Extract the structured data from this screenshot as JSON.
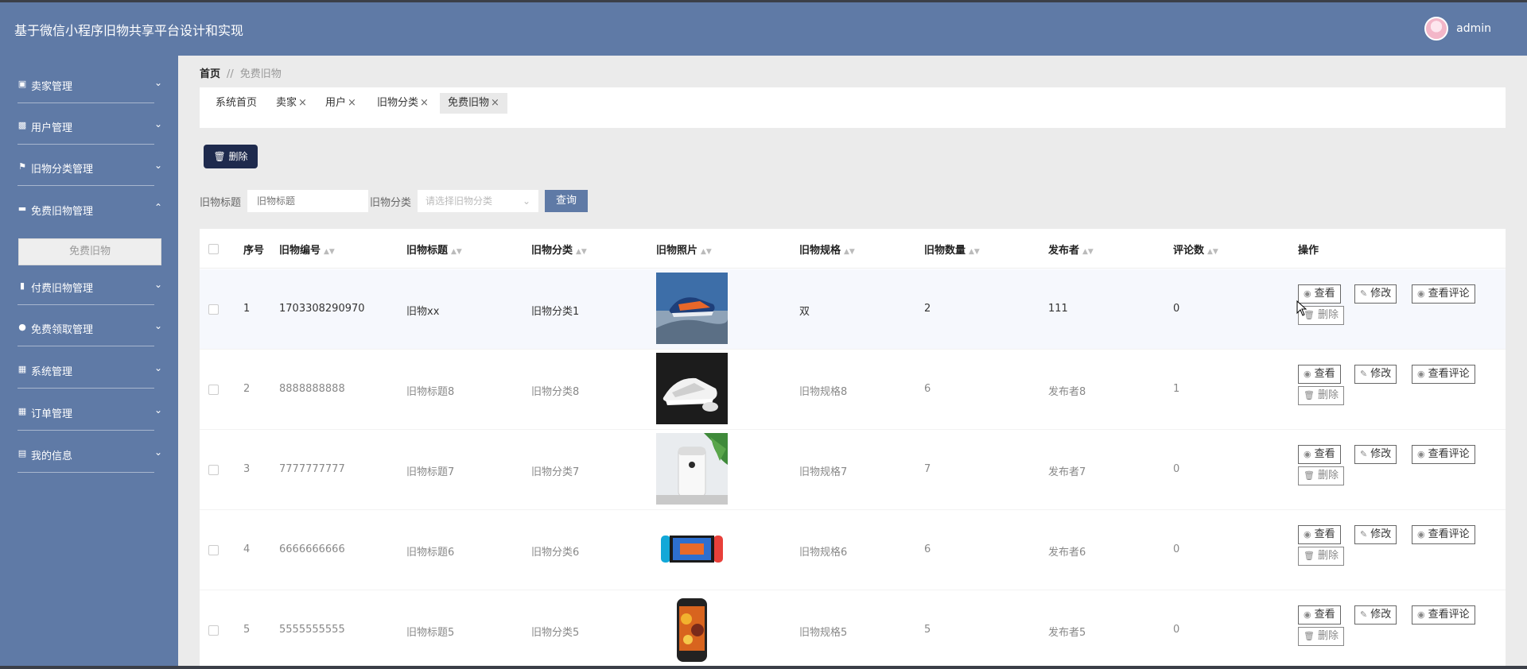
{
  "app": {
    "title": "基于微信小程序旧物共享平台设计和实现",
    "user": "admin"
  },
  "sidebar": {
    "items": [
      {
        "label": "卖家管理",
        "icon": "seller-icon"
      },
      {
        "label": "用户管理",
        "icon": "user-group-icon"
      },
      {
        "label": "旧物分类管理",
        "icon": "flag-icon"
      },
      {
        "label": "免费旧物管理",
        "icon": "ticket-icon",
        "expanded": true
      },
      {
        "label": "付费旧物管理",
        "icon": "bar-chart-icon"
      },
      {
        "label": "免费领取管理",
        "icon": "pin-icon"
      },
      {
        "label": "系统管理",
        "icon": "grid-icon"
      },
      {
        "label": "订单管理",
        "icon": "grid-icon"
      },
      {
        "label": "我的信息",
        "icon": "id-card-icon"
      }
    ],
    "submenu": "免费旧物"
  },
  "breadcrumb": {
    "home": "首页",
    "sep": "//",
    "current": "免费旧物"
  },
  "tabs": [
    {
      "label": "系统首页",
      "closable": false
    },
    {
      "label": "卖家",
      "closable": true
    },
    {
      "label": "用户",
      "closable": true
    },
    {
      "label": "旧物分类",
      "closable": true
    },
    {
      "label": "免费旧物",
      "closable": true,
      "active": true
    }
  ],
  "toolbar": {
    "delete_label": "删除"
  },
  "search": {
    "title_label": "旧物标题",
    "title_placeholder": "旧物标题",
    "category_label": "旧物分类",
    "category_placeholder": "请选择旧物分类",
    "query_label": "查询"
  },
  "table": {
    "headers": [
      "序号",
      "旧物编号",
      "旧物标题",
      "旧物分类",
      "旧物照片",
      "旧物规格",
      "旧物数量",
      "发布者",
      "评论数",
      "操作"
    ],
    "rows": [
      {
        "index": "1",
        "code": "1703308290970",
        "title": "旧物xx",
        "category": "旧物分类1",
        "photo": "shoe-blue-photo",
        "spec": "双",
        "qty": "2",
        "publisher": "111",
        "comments": "0"
      },
      {
        "index": "2",
        "code": "8888888888",
        "title": "旧物标题8",
        "category": "旧物分类8",
        "photo": "shoe-white-photo",
        "spec": "旧物规格8",
        "qty": "6",
        "publisher": "发布者8",
        "comments": "1"
      },
      {
        "index": "3",
        "code": "7777777777",
        "title": "旧物标题7",
        "category": "旧物分类7",
        "photo": "purifier-photo",
        "spec": "旧物规格7",
        "qty": "7",
        "publisher": "发布者7",
        "comments": "0"
      },
      {
        "index": "4",
        "code": "6666666666",
        "title": "旧物标题6",
        "category": "旧物分类6",
        "photo": "game-console-photo",
        "spec": "旧物规格6",
        "qty": "6",
        "publisher": "发布者6",
        "comments": "0"
      },
      {
        "index": "5",
        "code": "5555555555",
        "title": "旧物标题5",
        "category": "旧物分类5",
        "photo": "phone-photo",
        "spec": "旧物规格5",
        "qty": "5",
        "publisher": "发布者5",
        "comments": "0"
      }
    ],
    "actions": {
      "view": "查看",
      "edit": "修改",
      "view_comments": "查看评论",
      "delete": "删除"
    }
  },
  "colors": {
    "header": "#5f7aa6",
    "sidebar": "#5f7aa6",
    "primary_dark": "#1e2a4d",
    "row_highlight": "#f6f8fd"
  }
}
